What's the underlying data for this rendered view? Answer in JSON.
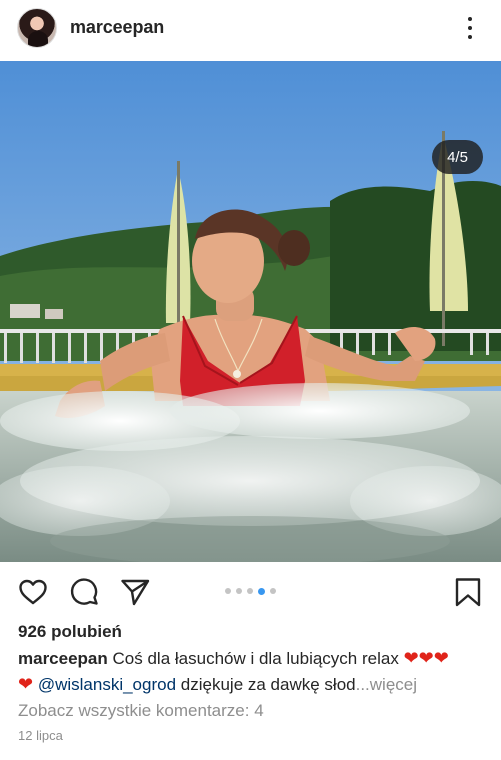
{
  "post": {
    "username": "marceepan",
    "counter": "4/5",
    "likes": "926 polubień",
    "caption": {
      "username": "marceepan",
      "text_before": "Coś dla łasuchów i dla lubiących relax",
      "hearts_line1": "❤❤❤",
      "heart_line2": "❤",
      "mention": "@wislanski_ogrod",
      "text_after": "dziękuje za dawkę słod",
      "more": "...więcej"
    },
    "view_comments": "Zobacz wszystkie komentarze: 4",
    "date": "12 lipca"
  },
  "carousel": {
    "total": 5,
    "active_index": 3
  },
  "icons": {
    "header": [
      "avatar",
      "more-options-icon"
    ],
    "actions": [
      "heart-icon",
      "comment-icon",
      "share-icon",
      "bookmark-icon"
    ]
  },
  "colors": {
    "heart_emoji": "#e0241a",
    "mention": "#003569",
    "muted": "#8e8e8e",
    "active_dot": "#3897f0"
  }
}
